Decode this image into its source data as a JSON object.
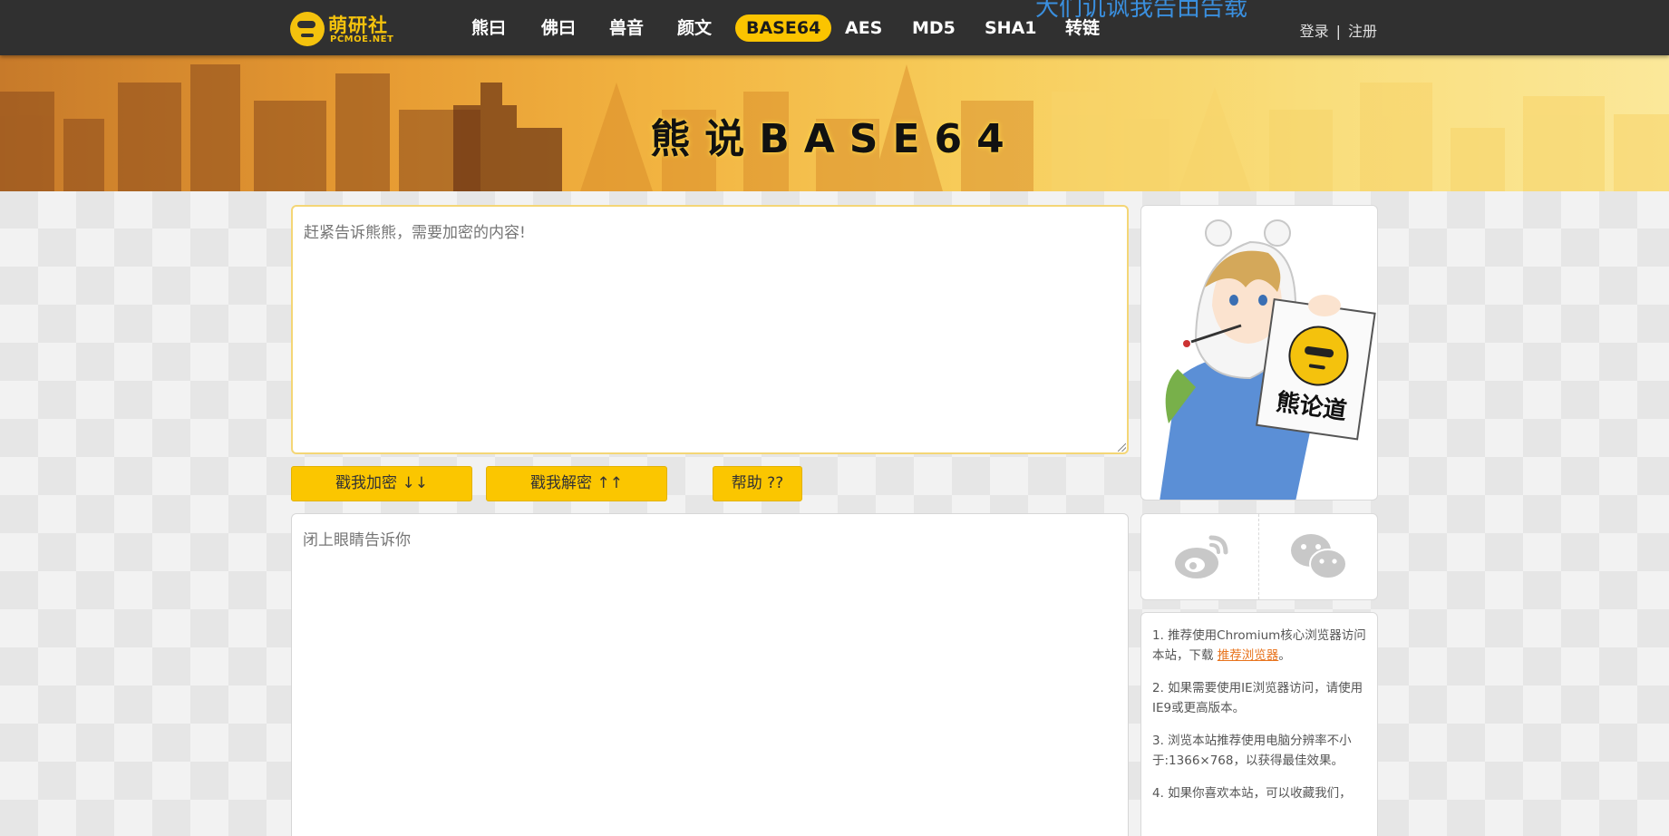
{
  "logo": {
    "cn": "萌研社",
    "en": "PCMOE.NET"
  },
  "nav": {
    "items": [
      {
        "label": "熊曰"
      },
      {
        "label": "佛曰"
      },
      {
        "label": "兽音"
      },
      {
        "label": "颜文"
      },
      {
        "label": "BASE64",
        "active": true
      },
      {
        "label": "AES"
      },
      {
        "label": "MD5"
      },
      {
        "label": "SHA1"
      },
      {
        "label": "转链"
      }
    ],
    "marquee": "大们讥讽我告由告载",
    "login": "登录",
    "separator": "|",
    "register": "注册"
  },
  "banner": {
    "title": "熊说BASE64"
  },
  "input": {
    "placeholder": "赶紧告诉熊熊，需要加密的内容!"
  },
  "output": {
    "placeholder": "闭上眼睛告诉你"
  },
  "buttons": {
    "encrypt": "戳我加密 ↓↓",
    "decrypt": "戳我解密 ↑↑",
    "help": "帮助 ??"
  },
  "mascot": {
    "sign_text": "熊论道"
  },
  "share": {
    "left_icon": "weibo-icon",
    "right_icon": "wechat-icon"
  },
  "tips": {
    "tip1_prefix": "1. 推荐使用Chromium核心浏览器访问本站，下载 ",
    "tip1_link": "推荐浏览器",
    "tip1_suffix": "。",
    "tip2": "2. 如果需要使用IE浏览器访问，请使用IE9或更高版本。",
    "tip3": "3. 浏览本站推荐使用电脑分辨率不小于:1366×768，以获得最佳效果。",
    "tip4": "4. 如果你喜欢本站，可以收藏我们，"
  },
  "colors": {
    "accent": "#fbc600",
    "navbar": "#303030",
    "link": "#e8741e"
  }
}
